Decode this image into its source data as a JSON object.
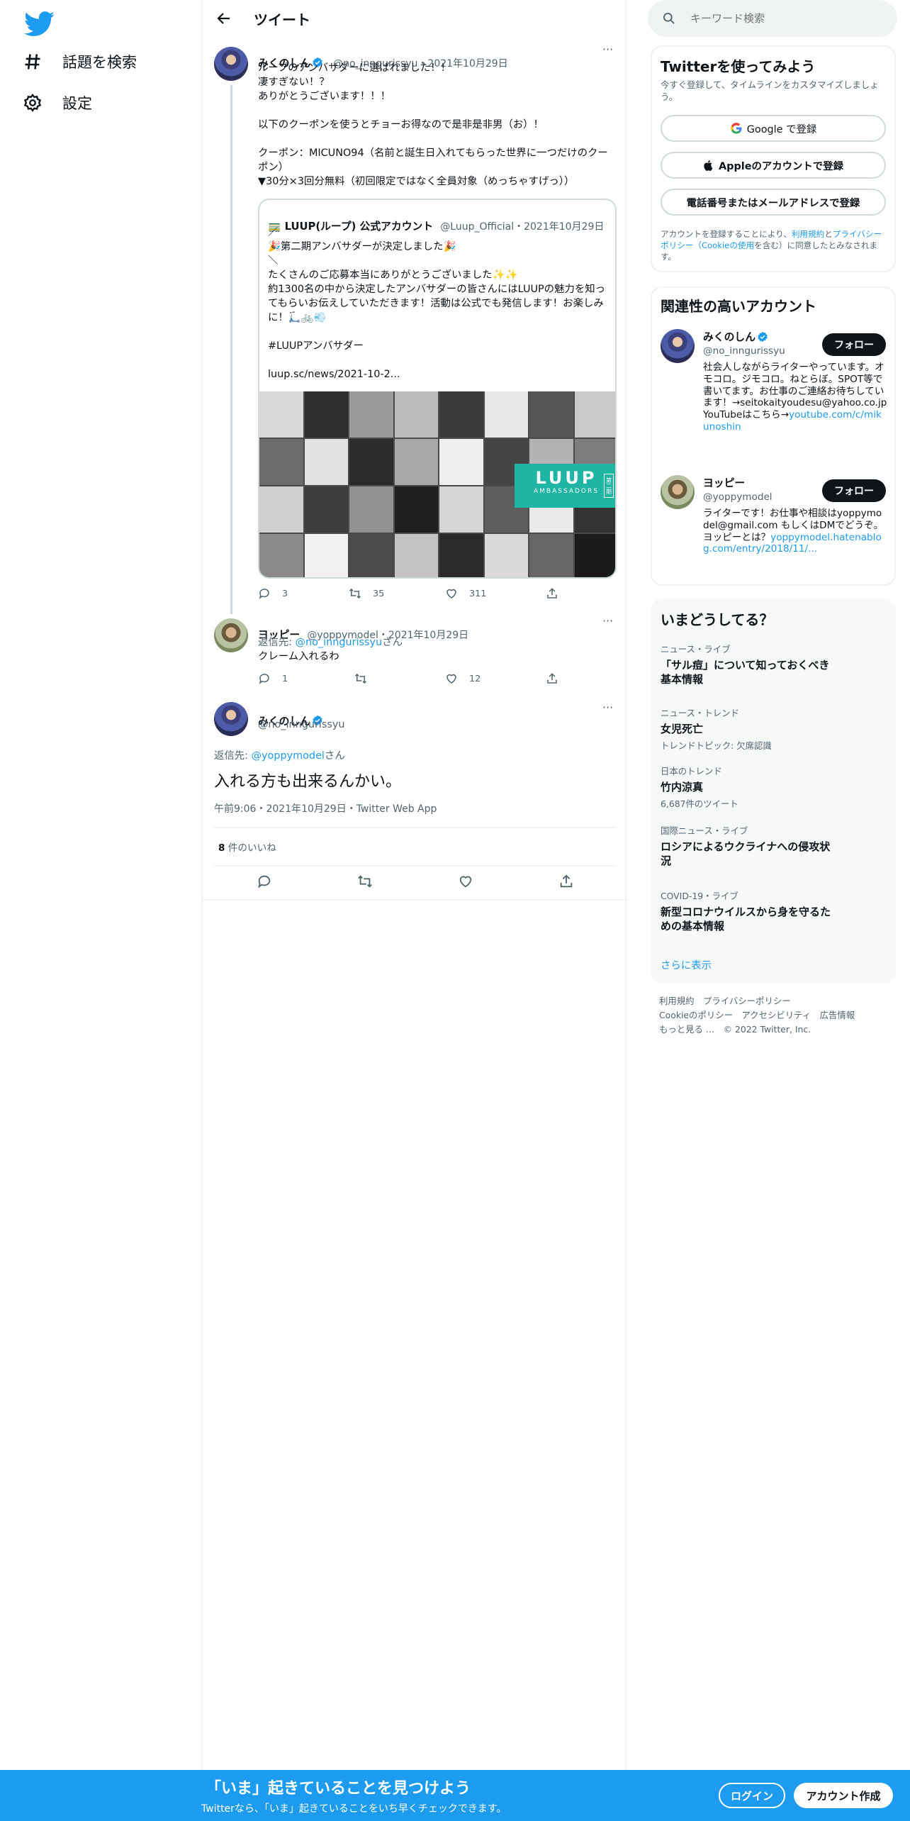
{
  "nav": {
    "explore": "話題を検索",
    "settings": "設定"
  },
  "header": {
    "title": "ツイート"
  },
  "tweet1": {
    "name": "みくのしん",
    "handle": "@no_inngurissyu",
    "date": "・2021年10月29日",
    "lines": [
      "ループのアンバサダーに選ばれました！！",
      "凄すぎない！？",
      "ありがとうございます！！！",
      "",
      "以下のクーポンを使うとチョーお得なので是非是非男（お）！",
      "",
      "クーポン：MICUNO94（名前と誕生日入れてもらった世界に一つだけのクーポン）",
      "▼30分×3回分無料（初回限定ではなく全員対象（めっちゃすげっ））"
    ],
    "replies": "3",
    "retweets": "35",
    "likes": "311"
  },
  "quote": {
    "name": "🚃 LUUP(ループ) 公式アカウント",
    "handle": "@Luup_Official",
    "date": "・2021年10月29日",
    "lines": [
      "／",
      "🎉第二期アンバサダーが決定しました🎉",
      "＼",
      "たくさんのご応募本当にありがとうございました✨✨",
      "約1300名の中から決定したアンバサダーの皆さんにはLUUPの魅力を知ってもらいお伝えしていただきます！活動は公式でも発信します！お楽しみに！🛴🚲💨",
      "",
      "#LUUPアンバサダー",
      "",
      "luup.sc/news/2021-10-2..."
    ],
    "image_logo": "LUUP",
    "image_sub": "AMBASSADORS",
    "image_tag": "第二期"
  },
  "tweet2": {
    "name": "ヨッピー",
    "handle": "@yoppymodel",
    "date": "・2021年10月29日",
    "reply_prefix": "返信先: ",
    "reply_to": "@no_inngurissyu",
    "reply_suffix": "さん",
    "text": "クレーム入れるわ",
    "replies": "1",
    "retweets": "",
    "likes": "12"
  },
  "main_tweet": {
    "name": "みくのしん",
    "handle": "@no_inngurissyu",
    "reply_prefix": "返信先: ",
    "reply_to": "@yoppymodel",
    "reply_suffix": "さん",
    "text": "入れる方も出来るんかい。",
    "timestamp": "午前9:06・2021年10月29日・Twitter Web App",
    "likes_count": "8",
    "likes_label": " 件のいいね"
  },
  "right": {
    "search_placeholder": "キーワード検索",
    "signup": {
      "title": "Twitterを使ってみよう",
      "subtitle": "今すぐ登録して、タイムラインをカスタマイズしましょう。",
      "google": "Google で登録",
      "apple": "Appleのアカウントで登録",
      "phone": "電話番号またはメールアドレスで登録",
      "terms_a": "アカウントを登録することにより、",
      "terms_link1": "利用規約",
      "terms_b": "と",
      "terms_link2": "プライバシーポリシー（Cookieの使用",
      "terms_c": "を含む）に同意したとみなされます。"
    },
    "related": {
      "title": "関連性の高いアカウント",
      "follow": "フォロー",
      "accounts": [
        {
          "name": "みくのしん",
          "handle": "@no_inngurissyu",
          "bio": "社会人しながらライターやっています。オモコロ。ジモコロ。ねとらぼ。SPOT等で書いてます。お仕事のご連絡お待ちしています！→seitokaityoudesu@yahoo.co.jp　YouTubeはこちら→",
          "bio_link": "youtube.com/c/mikunoshin"
        },
        {
          "name": "ヨッピー",
          "handle": "@yoppymodel",
          "bio": "ライターです！お仕事や相談はyoppymodel@gmail.com もしくはDMでどうぞ。 ヨッピーとは？",
          "bio_link": "yoppymodel.hatenablog.com/entry/2018/11/..."
        }
      ]
    },
    "trends": {
      "title": "いまどうしてる？",
      "items": [
        {
          "category": "ニュース・ライブ",
          "title": "「サル痘」について知っておくべき基本情報",
          "extra": ""
        },
        {
          "category": "ニュース・トレンド",
          "title": "女児死亡",
          "extra": "トレンドトピック: 欠席認識"
        },
        {
          "category": "日本のトレンド",
          "title": "竹内涼真",
          "extra": "6,687件のツイート"
        },
        {
          "category": "国際ニュース・ライブ",
          "title": "ロシアによるウクライナへの侵攻状況",
          "extra": ""
        },
        {
          "category": "COVID-19・ライブ",
          "title": "新型コロナウイルスから身を守るための基本情報",
          "extra": ""
        }
      ],
      "more": "さらに表示"
    },
    "footer": {
      "l1a": "利用規約",
      "l1b": "プライバシーポリシー",
      "l2a": "Cookieのポリシー",
      "l2b": "アクセシビリティ",
      "l2c": "広告情報",
      "l3a": "もっと見る …",
      "l3b": "© 2022 Twitter, Inc."
    }
  },
  "bottom_bar": {
    "title": "「いま」起きていることを見つけよう",
    "subtitle": "Twitterなら、「いま」起きていることをいち早くチェックできます。",
    "login": "ログイン",
    "signup": "アカウント作成"
  },
  "colors": {
    "accent": "#1d9bf0",
    "text": "#0f1419",
    "muted": "#536471",
    "teal": "#1fb5a5"
  }
}
